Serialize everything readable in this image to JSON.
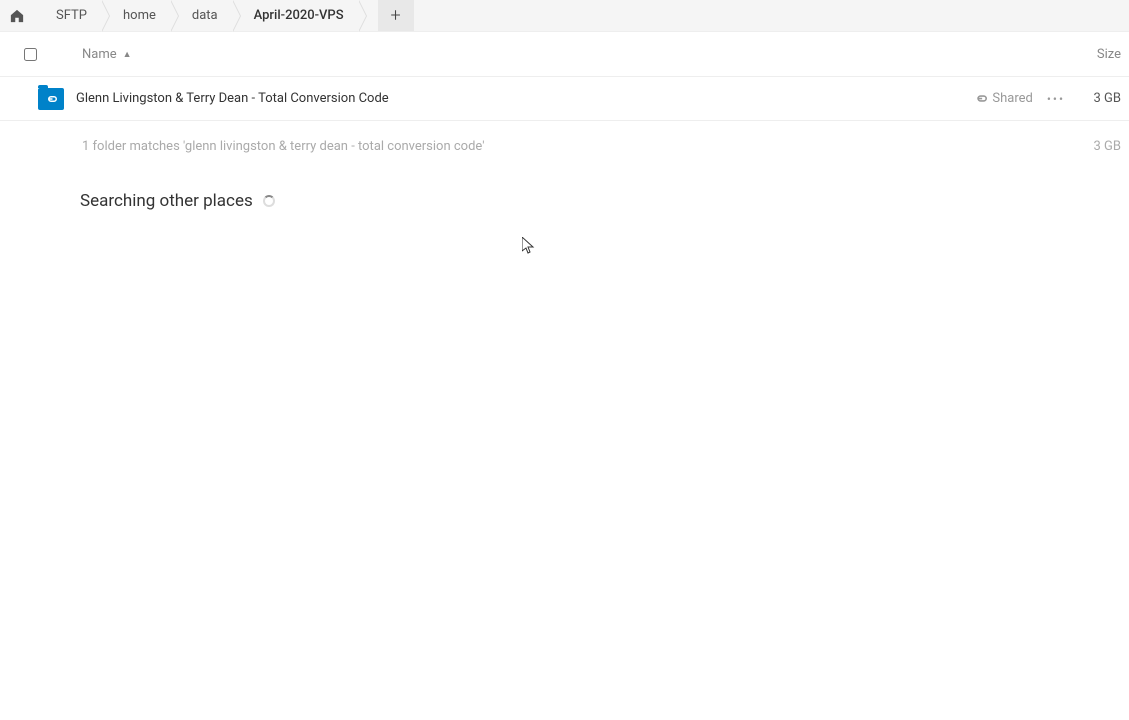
{
  "breadcrumb": {
    "items": [
      {
        "label": "SFTP"
      },
      {
        "label": "home"
      },
      {
        "label": "data"
      },
      {
        "label": "April-2020-VPS"
      }
    ]
  },
  "table": {
    "name_header": "Name",
    "size_header": "Size"
  },
  "files": [
    {
      "name": "Glenn Livingston & Terry Dean - Total Conversion Code",
      "shared_label": "Shared",
      "size": "3 GB"
    }
  ],
  "summary": {
    "text": "1 folder matches 'glenn livingston & terry dean - total conversion code'",
    "size": "3 GB"
  },
  "searching": {
    "label": "Searching other places"
  }
}
